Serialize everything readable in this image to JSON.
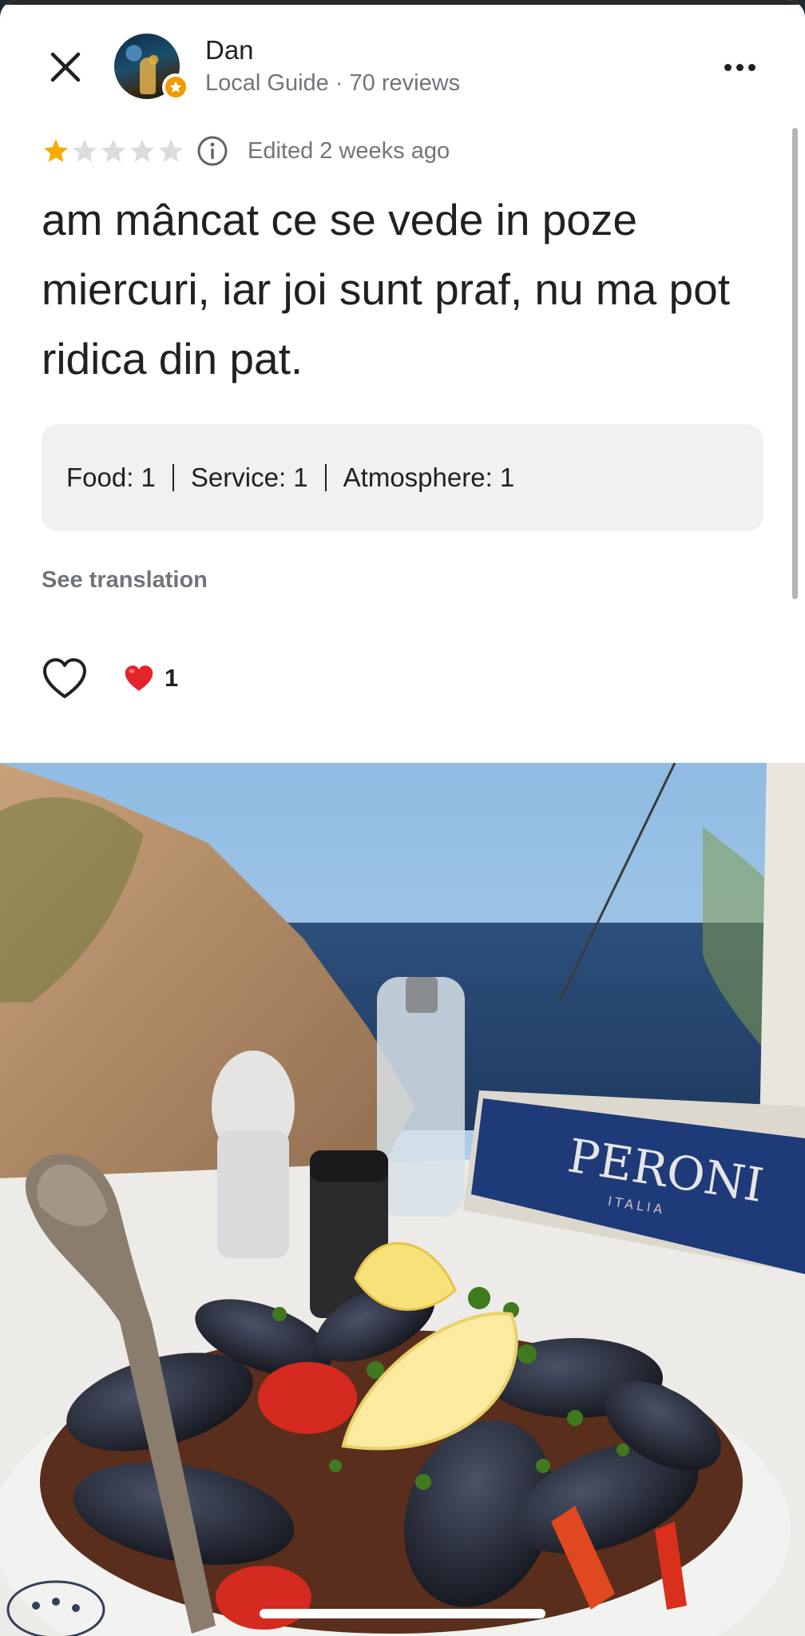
{
  "header": {
    "user_name": "Dan",
    "user_meta": "Local Guide · 70 reviews"
  },
  "rating": {
    "stars": 1,
    "max_stars": 5,
    "edited_label": "Edited 2 weeks ago"
  },
  "review": {
    "text": "am mâncat ce se vede in poze miercuri, iar joi sunt praf, nu ma pot ridica din pat."
  },
  "scores": {
    "food": "Food: 1",
    "service": "Service: 1",
    "atmosphere": "Atmosphere: 1"
  },
  "see_translation": "See translation",
  "reactions": {
    "heart_count": "1"
  },
  "photo": {
    "sign_text": "PERONI",
    "sign_subtext": "ITALIA"
  },
  "colors": {
    "star_filled": "#f9ab00",
    "star_empty": "#dadce0",
    "text_primary": "#202124",
    "text_secondary": "#70757a",
    "score_bg": "#f1f1f1",
    "heart_red": "#e3242b"
  },
  "icons": [
    "close-icon",
    "more-icon",
    "star-icon",
    "info-icon",
    "heart-outline-icon",
    "heart-emoji-icon",
    "local-guide-badge-icon"
  ]
}
